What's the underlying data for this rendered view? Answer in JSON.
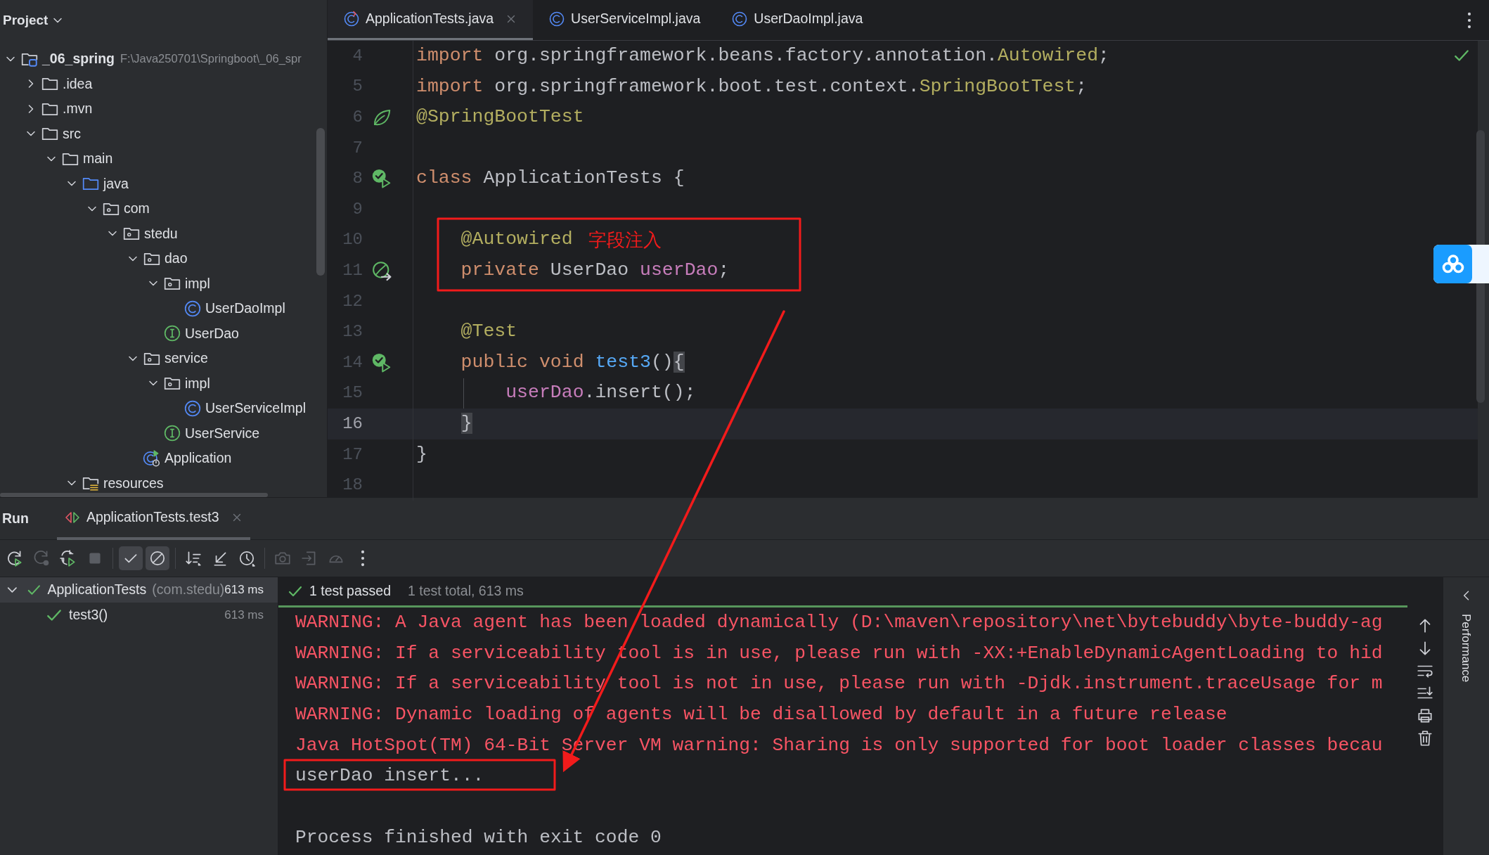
{
  "project_panel": {
    "title": "Project",
    "tree": [
      {
        "kind": "root",
        "label": "_06_spring",
        "path": "F:\\Java250701\\Springboot\\_06_spr",
        "expanded": true,
        "children": [
          {
            "kind": "folder",
            "label": ".idea",
            "expanded": false
          },
          {
            "kind": "folder",
            "label": ".mvn",
            "expanded": false
          },
          {
            "kind": "folder",
            "label": "src",
            "expanded": true,
            "children": [
              {
                "kind": "folder",
                "label": "main",
                "expanded": true,
                "children": [
                  {
                    "kind": "source",
                    "label": "java",
                    "expanded": true,
                    "children": [
                      {
                        "kind": "package",
                        "label": "com",
                        "expanded": true,
                        "children": [
                          {
                            "kind": "package",
                            "label": "stedu",
                            "expanded": true,
                            "children": [
                              {
                                "kind": "package",
                                "label": "dao",
                                "expanded": true,
                                "children": [
                                  {
                                    "kind": "package",
                                    "label": "impl",
                                    "expanded": true,
                                    "children": [
                                      {
                                        "kind": "class",
                                        "label": "UserDaoImpl"
                                      }
                                    ]
                                  },
                                  {
                                    "kind": "interface",
                                    "label": "UserDao"
                                  }
                                ]
                              },
                              {
                                "kind": "package",
                                "label": "service",
                                "expanded": true,
                                "children": [
                                  {
                                    "kind": "package",
                                    "label": "impl",
                                    "expanded": true,
                                    "children": [
                                      {
                                        "kind": "class",
                                        "label": "UserServiceImpl"
                                      }
                                    ]
                                  },
                                  {
                                    "kind": "interface",
                                    "label": "UserService"
                                  }
                                ]
                              },
                              {
                                "kind": "app",
                                "label": "Application"
                              }
                            ]
                          }
                        ]
                      }
                    ]
                  },
                  {
                    "kind": "resources",
                    "label": "resources",
                    "expanded": true
                  }
                ]
              }
            ]
          }
        ]
      }
    ]
  },
  "editor": {
    "tabs": [
      {
        "label": "ApplicationTests.java",
        "kind": "test",
        "selected": true
      },
      {
        "label": "UserServiceImpl.java",
        "kind": "class",
        "selected": false
      },
      {
        "label": "UserDaoImpl.java",
        "kind": "class",
        "selected": false
      }
    ],
    "lines": [
      {
        "number": "4",
        "current": false,
        "tokens": [
          {
            "kind": "kw",
            "text": "import"
          },
          {
            "kind": "plain",
            "text": " org.springframework.beans.factory.annotation."
          },
          {
            "kind": "ann",
            "text": "Autowired"
          },
          {
            "kind": "plain",
            "text": ";"
          }
        ]
      },
      {
        "number": "5",
        "current": false,
        "tokens": [
          {
            "kind": "kw",
            "text": "import"
          },
          {
            "kind": "plain",
            "text": " org.springframework.boot.test.context."
          },
          {
            "kind": "ann",
            "text": "SpringBootTest"
          },
          {
            "kind": "plain",
            "text": ";"
          }
        ]
      },
      {
        "number": "6",
        "current": false,
        "gutter": {
          "kind": "bean"
        },
        "tokens": [
          {
            "kind": "ann",
            "text": "@SpringBootTest"
          }
        ]
      },
      {
        "number": "7",
        "current": false
      },
      {
        "number": "8",
        "current": false,
        "gutter": {
          "kind": "run"
        },
        "tokens": [
          {
            "kind": "kw",
            "text": "class"
          },
          {
            "kind": "plain",
            "text": " ApplicationTests {"
          }
        ]
      },
      {
        "number": "9",
        "current": false
      },
      {
        "number": "10",
        "current": false,
        "note": "字段注入",
        "tokens": [
          {
            "kind": "ann",
            "text": "    @Autowired"
          }
        ]
      },
      {
        "number": "11",
        "current": false,
        "gutter": {
          "kind": "autowire"
        },
        "tokens": [
          {
            "kind": "kw",
            "text": "    private"
          },
          {
            "kind": "plain",
            "text": " UserDao "
          },
          {
            "kind": "field",
            "text": "userDao"
          },
          {
            "kind": "plain",
            "text": ";"
          }
        ]
      },
      {
        "number": "12",
        "current": false
      },
      {
        "number": "13",
        "current": false,
        "tokens": [
          {
            "kind": "ann",
            "text": "    @Test"
          }
        ]
      },
      {
        "number": "14",
        "current": false,
        "gutter": {
          "kind": "run"
        },
        "tokens": [
          {
            "kind": "kw",
            "text": "    public void "
          },
          {
            "kind": "method",
            "text": "test3"
          },
          {
            "kind": "plain",
            "text": "()"
          },
          {
            "kind": "brace",
            "text": "{"
          }
        ]
      },
      {
        "number": "15",
        "current": false,
        "guide": true,
        "tokens": [
          {
            "kind": "field",
            "text": "        userDao"
          },
          {
            "kind": "plain",
            "text": ".insert();"
          }
        ]
      },
      {
        "number": "16",
        "current": true,
        "tokens": [
          {
            "kind": "brace",
            "text": "    }"
          }
        ]
      },
      {
        "number": "17",
        "current": false,
        "tokens": [
          {
            "kind": "plain",
            "text": "}"
          }
        ]
      },
      {
        "number": "18",
        "current": false
      }
    ]
  },
  "run_panel": {
    "title": "Run",
    "tabs": [
      {
        "label": "ApplicationTests.test3",
        "selected": true
      }
    ],
    "toolbar": [
      [
        {
          "kind": "rerun",
          "on": false,
          "disabled": false
        },
        {
          "kind": "rerun-failed",
          "on": false,
          "disabled": true
        },
        {
          "kind": "auto-test",
          "on": false,
          "disabled": false
        },
        {
          "kind": "stop",
          "on": false,
          "disabled": true
        }
      ],
      [
        {
          "kind": "show-passed",
          "on": true,
          "disabled": false
        },
        {
          "kind": "show-ignored",
          "on": true,
          "disabled": false
        }
      ],
      [
        {
          "kind": "sort",
          "on": false,
          "disabled": false
        },
        {
          "kind": "collapse",
          "on": false,
          "disabled": false
        },
        {
          "kind": "history",
          "on": false,
          "disabled": false
        }
      ],
      [
        {
          "kind": "camera",
          "on": false,
          "disabled": true
        },
        {
          "kind": "export",
          "on": false,
          "disabled": true
        },
        {
          "kind": "gauge",
          "on": false,
          "disabled": true
        },
        {
          "kind": "more",
          "on": false,
          "disabled": false
        }
      ]
    ],
    "tests": [
      {
        "name": "ApplicationTests",
        "package": "(com.stedu)",
        "time": "613 ms",
        "passed": true,
        "expanded": true,
        "selected": true,
        "children": [
          {
            "name": "test3()",
            "time": "613 ms",
            "passed": true,
            "selected": false
          }
        ]
      }
    ],
    "status": {
      "summary": "1 test passed",
      "detail": "1 test total, 613 ms",
      "passed": true
    },
    "progress": {
      "level": 1
    },
    "console": [
      {
        "kind": "err",
        "text": "WARNING: A Java agent has been loaded dynamically (D:\\maven\\repository\\net\\bytebuddy\\byte-buddy-ag"
      },
      {
        "kind": "err",
        "text": "WARNING: If a serviceability tool is in use, please run with -XX:+EnableDynamicAgentLoading to hid"
      },
      {
        "kind": "err",
        "text": "WARNING: If a serviceability tool is not in use, please run with -Djdk.instrument.traceUsage for m"
      },
      {
        "kind": "err",
        "text": "WARNING: Dynamic loading of agents will be disallowed by default in a future release"
      },
      {
        "kind": "err",
        "text": "Java HotSpot(TM) 64-Bit Server VM warning: Sharing is only supported for boot loader classes becau"
      },
      {
        "kind": "out",
        "text": "userDao insert..."
      },
      {
        "kind": "blank"
      },
      {
        "kind": "out",
        "text": "Process finished with exit code 0"
      }
    ]
  },
  "side_panel": {
    "label": "Performance"
  }
}
